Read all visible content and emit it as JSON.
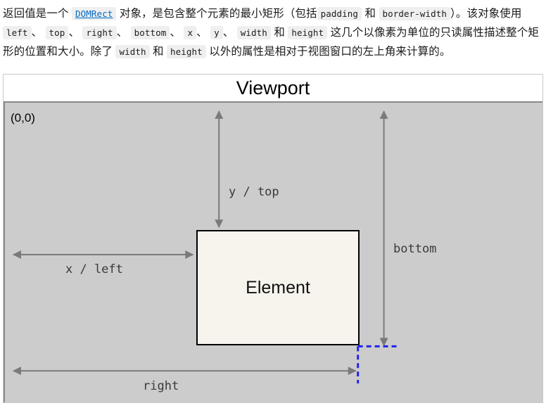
{
  "prose": {
    "line1_a": "返回值是一个",
    "link_domrect": "DOMRect",
    "line1_b": "对象，是包含整个元素的最小矩形（包括",
    "code_padding": "padding",
    "line1_c": "和",
    "code_border_width": "border-width",
    "line1_d": "）。该对象使用",
    "code_left": "left",
    "sep1": "、",
    "code_top": "top",
    "sep2": "、",
    "code_right": "right",
    "sep3": "、",
    "code_bottom": "bottom",
    "sep4": "、",
    "code_x": "x",
    "sep5": "、",
    "code_y": "y",
    "sep6": "、",
    "code_width": "width",
    "line2_a": "和",
    "code_height": "height",
    "line2_b": "这几个以像素为单位的只读属性描述整个矩形的位置和大小。除了",
    "code_width2": "width",
    "line3_a": "和",
    "code_height2": "height",
    "line3_b": "以外的属性是相对于视图窗口的左上角来计算的。"
  },
  "diagram": {
    "title": "Viewport",
    "origin": "(0,0)",
    "element_label": "Element",
    "labels": {
      "y_top": "y / top",
      "bottom": "bottom",
      "x_left": "x / left",
      "right": "right"
    },
    "colors": {
      "viewport_fill": "#cccccc",
      "element_fill": "#f7f4ee",
      "element_border": "#000000",
      "arrow": "#7a7a7a",
      "guide": "#2222ee",
      "link": "#0069c2",
      "code_bg": "#efeff0"
    }
  }
}
